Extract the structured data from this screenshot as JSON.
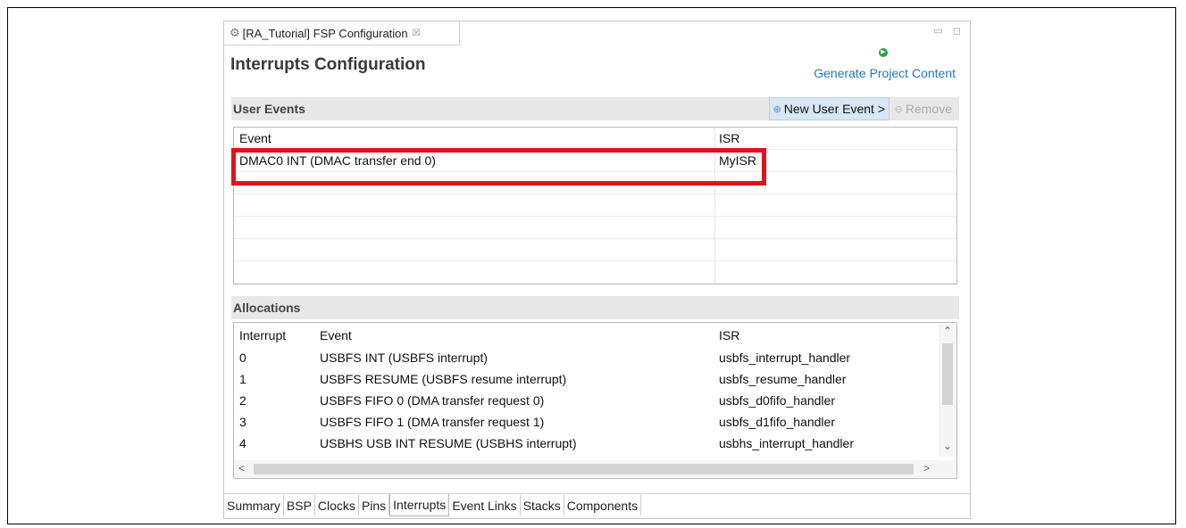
{
  "editor_tab": {
    "label": "[RA_Tutorial] FSP Configuration",
    "close": "☒"
  },
  "window_controls": "▭ ◻",
  "page_title": "Interrupts Configuration",
  "generate_link": "Generate Project Content",
  "user_events": {
    "heading": "User Events",
    "new_button": "New User Event >",
    "remove_button": "Remove",
    "columns": [
      "Event",
      "ISR"
    ],
    "rows": [
      {
        "event": "DMAC0 INT (DMAC transfer end 0)",
        "isr": "MyISR"
      }
    ]
  },
  "allocations": {
    "heading": "Allocations",
    "columns": [
      "Interrupt",
      "Event",
      "ISR"
    ],
    "rows": [
      {
        "interrupt": "0",
        "event": "USBFS INT (USBFS interrupt)",
        "isr": "usbfs_interrupt_handler"
      },
      {
        "interrupt": "1",
        "event": "USBFS RESUME (USBFS resume interrupt)",
        "isr": "usbfs_resume_handler"
      },
      {
        "interrupt": "2",
        "event": "USBFS FIFO 0 (DMA transfer request 0)",
        "isr": "usbfs_d0fifo_handler"
      },
      {
        "interrupt": "3",
        "event": "USBFS FIFO 1 (DMA transfer request 1)",
        "isr": "usbfs_d1fifo_handler"
      },
      {
        "interrupt": "4",
        "event": "USBHS USB INT RESUME (USBHS interrupt)",
        "isr": "usbhs_interrupt_handler"
      }
    ]
  },
  "bottom_tabs": [
    "Summary",
    "BSP",
    "Clocks",
    "Pins",
    "Interrupts",
    "Event Links",
    "Stacks",
    "Components"
  ],
  "active_tab": "Interrupts",
  "colors": {
    "highlight": "#e0121c",
    "link": "#1e7aca",
    "section_bg": "#e8e8e8"
  }
}
